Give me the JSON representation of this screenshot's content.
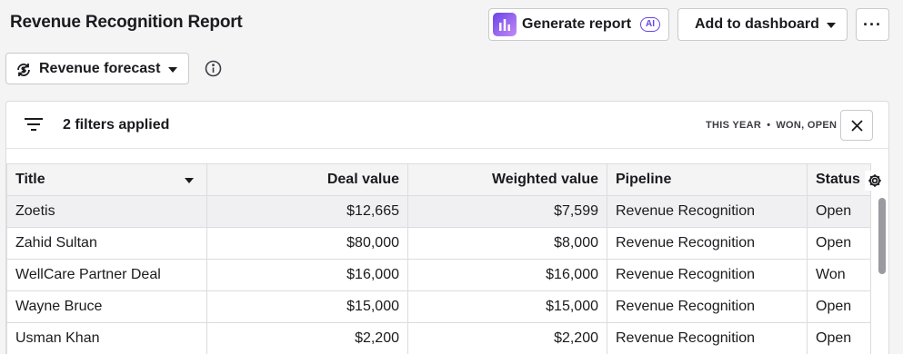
{
  "page_title": "Revenue Recognition Report",
  "toolbar": {
    "generate_label": "Generate report",
    "ai_badge": "AI",
    "dashboard_label": "Add to dashboard",
    "more_label": "···",
    "forecast_label": "Revenue forecast"
  },
  "filters": {
    "applied_label": "2 filters applied",
    "period": "THIS YEAR",
    "separator": "•",
    "statuses": "WON, OPEN"
  },
  "table": {
    "columns": [
      "Title",
      "Deal value",
      "Weighted value",
      "Pipeline",
      "Status"
    ],
    "rows": [
      {
        "title": "Zoetis",
        "deal_value": "$12,665",
        "weighted_value": "$7,599",
        "pipeline": "Revenue Recognition",
        "status": "Open"
      },
      {
        "title": "Zahid Sultan",
        "deal_value": "$80,000",
        "weighted_value": "$8,000",
        "pipeline": "Revenue Recognition",
        "status": "Open"
      },
      {
        "title": "WellCare Partner Deal",
        "deal_value": "$16,000",
        "weighted_value": "$16,000",
        "pipeline": "Revenue Recognition",
        "status": "Won"
      },
      {
        "title": "Wayne Bruce",
        "deal_value": "$15,000",
        "weighted_value": "$15,000",
        "pipeline": "Revenue Recognition",
        "status": "Open"
      },
      {
        "title": "Usman Khan",
        "deal_value": "$2,200",
        "weighted_value": "$2,200",
        "pipeline": "Revenue Recognition",
        "status": "Open"
      }
    ]
  },
  "icons": {
    "generate": "bar-chart-icon",
    "forecast": "refresh-dollar-icon",
    "info": "info-icon",
    "filter": "filter-icon",
    "close": "close-icon",
    "settings": "gear-icon"
  },
  "colors": {
    "accent": "#6a43e8",
    "background": "#f4f4f5",
    "scrollbar": "#9a9aa0"
  }
}
